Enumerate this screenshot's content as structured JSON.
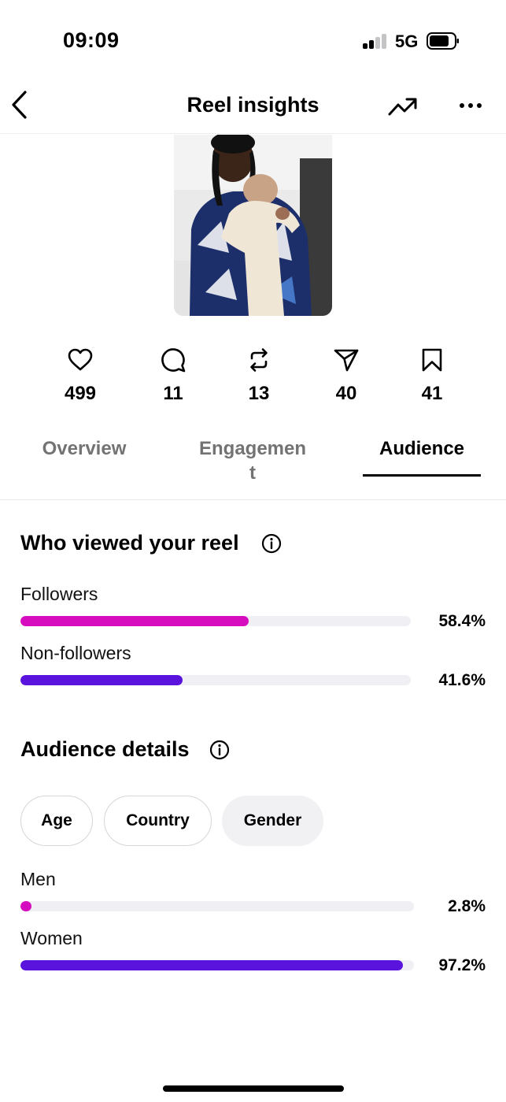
{
  "status_bar": {
    "time": "09:09",
    "network": "5G"
  },
  "header": {
    "title": "Reel insights",
    "icons": [
      "chevron-left-icon",
      "trending-up-icon",
      "more-horizontal-icon"
    ]
  },
  "stats": [
    {
      "icon": "heart-icon",
      "value": "499"
    },
    {
      "icon": "comment-icon",
      "value": "11"
    },
    {
      "icon": "repost-icon",
      "value": "13"
    },
    {
      "icon": "send-icon",
      "value": "40"
    },
    {
      "icon": "bookmark-icon",
      "value": "41"
    }
  ],
  "tabs": [
    {
      "label": "Overview",
      "selected": false
    },
    {
      "label_line1": "Engagemen",
      "label_line2": "t",
      "selected": false
    },
    {
      "label": "Audience",
      "selected": true
    }
  ],
  "viewers": {
    "title": "Who viewed your reel",
    "rows": [
      {
        "label": "Followers",
        "value_text": "58.4%",
        "value": 58.4,
        "color": "#d60dbf"
      },
      {
        "label": "Non-followers",
        "value_text": "41.6%",
        "value": 41.6,
        "color": "#5a12dd"
      }
    ]
  },
  "audience": {
    "title": "Audience details",
    "chips": [
      {
        "label": "Age",
        "selected": false
      },
      {
        "label": "Country",
        "selected": false
      },
      {
        "label": "Gender",
        "selected": true
      }
    ],
    "rows": [
      {
        "label": "Men",
        "value_text": "2.8%",
        "value": 2.8,
        "color": "#d60dbf"
      },
      {
        "label": "Women",
        "value_text": "97.2%",
        "value": 97.2,
        "color": "#5a12dd"
      }
    ]
  }
}
